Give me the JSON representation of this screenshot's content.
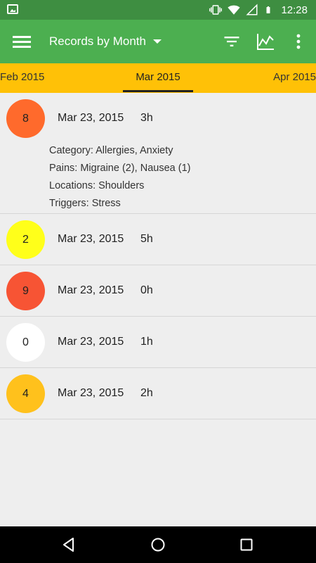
{
  "status_bar": {
    "time": "12:28",
    "icons": [
      "image-notification-icon",
      "vibrate-icon",
      "wifi-icon",
      "signal-icon",
      "battery-icon"
    ]
  },
  "app_bar": {
    "title": "Records by Month",
    "icons": [
      "menu-icon",
      "dropdown-caret-icon",
      "filter-icon",
      "chart-icon",
      "more-vert-icon"
    ]
  },
  "tabs": {
    "prev": "Feb 2015",
    "current": "Mar 2015",
    "next": "Apr 2015"
  },
  "records": [
    {
      "score": "8",
      "color": "#ff6a2c",
      "date": "Mar 23, 2015",
      "duration": "3h",
      "expanded": true,
      "details": [
        "Category: Allergies, Anxiety",
        "Pains: Migraine (2), Nausea (1)",
        "Locations: Shoulders",
        "Triggers: Stress"
      ]
    },
    {
      "score": "2",
      "color": "#ffff1a",
      "date": "Mar 23, 2015",
      "duration": "5h",
      "expanded": false
    },
    {
      "score": "9",
      "color": "#f75434",
      "date": "Mar 23, 2015",
      "duration": "0h",
      "expanded": false
    },
    {
      "score": "0",
      "color": "#ffffff",
      "date": "Mar 23, 2015",
      "duration": "1h",
      "expanded": false
    },
    {
      "score": "4",
      "color": "#ffc11c",
      "date": "Mar 23, 2015",
      "duration": "2h",
      "expanded": false
    }
  ],
  "colors": {
    "status_bar": "#3e8e41",
    "app_bar": "#4caf50",
    "tab_bar": "#ffc107",
    "background": "#eeeeee"
  }
}
